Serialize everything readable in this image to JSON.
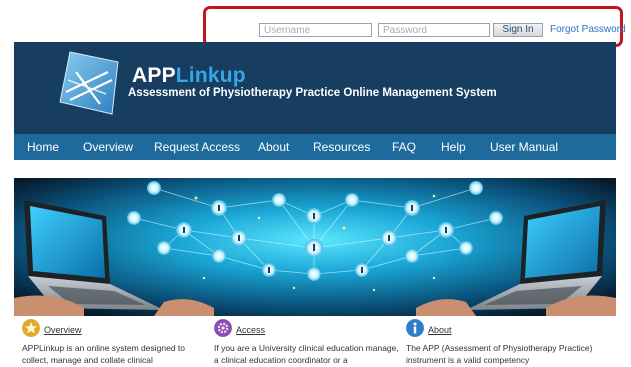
{
  "login": {
    "username_placeholder": "Username",
    "password_placeholder": "Password",
    "signin_label": "Sign In",
    "forgot_label": "Forgot Password"
  },
  "header": {
    "brand_app": "APP",
    "brand_link": "Linkup",
    "subtitle": "Assessment of Physiotherapy Practice Online Management System"
  },
  "nav": {
    "items": [
      "Home",
      "Overview",
      "Request Access",
      "About",
      "Resources",
      "FAQ",
      "Help",
      "User Manual"
    ]
  },
  "columns": [
    {
      "title": "Overview",
      "icon": "star-icon",
      "text": "APPLinkup is an online system designed to collect, manage and collate clinical"
    },
    {
      "title": "Access",
      "icon": "gear-icon",
      "text": "If you are a University clinical education manage, a clinical education coordinator or a"
    },
    {
      "title": "About",
      "icon": "info-icon",
      "text": "The APP (Assessment of Physiotherapy Practice) instrument is a valid competency"
    }
  ],
  "colors": {
    "header_bg": "#173d60",
    "nav_bg": "#1f6a9c",
    "brand_accent": "#35a6e6",
    "highlight": "#c2161b",
    "link": "#2b74c2"
  }
}
